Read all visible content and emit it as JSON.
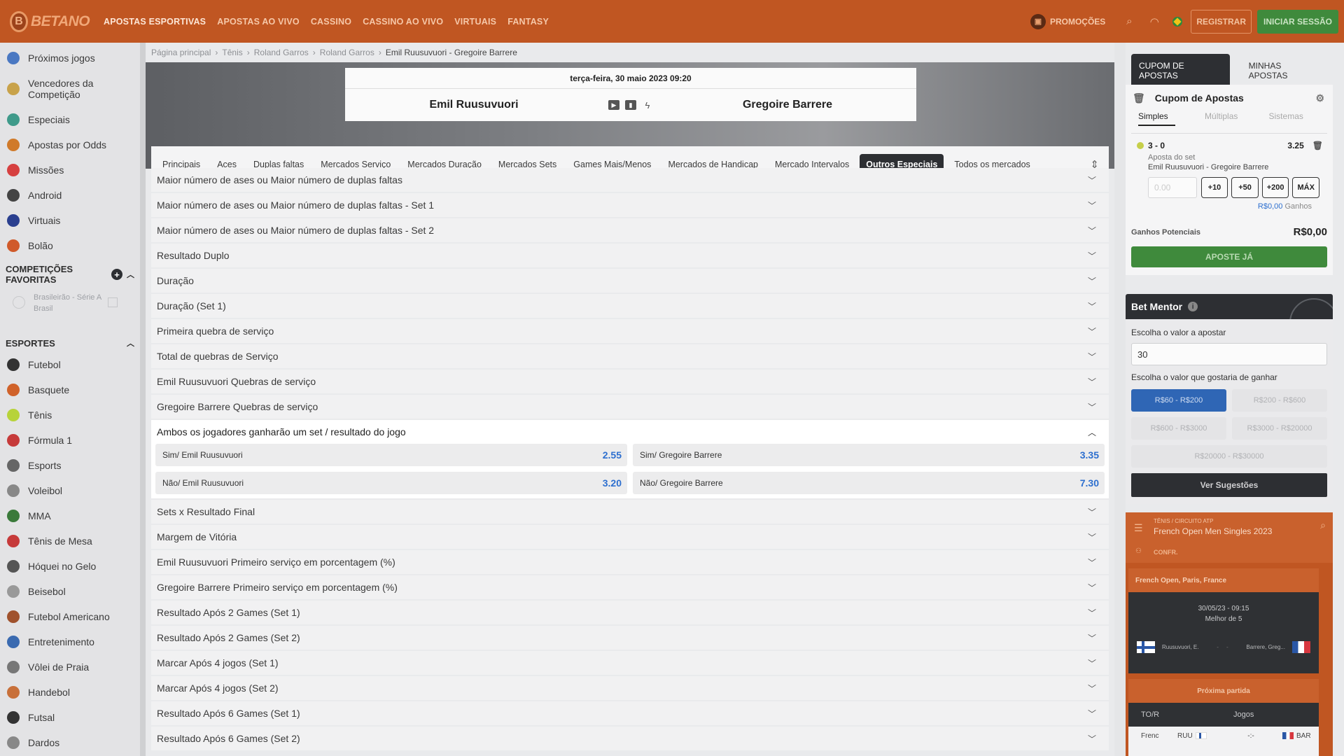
{
  "header": {
    "logo_letter": "B",
    "logo_text": "BETANO",
    "nav": [
      "APOSTAS ESPORTIVAS",
      "APOSTAS AO VIVO",
      "CASSINO",
      "CASSINO AO VIVO",
      "VIRTUAIS",
      "FANTASY"
    ],
    "promotions": "PROMOÇÕES",
    "register": "REGISTRAR",
    "login": "INICIAR SESSÃO"
  },
  "sidebar": {
    "top_items": [
      {
        "label": "Próximos jogos",
        "icon": "calendar-icon",
        "color": "#4a78c2"
      },
      {
        "label": "Vencedores da Competição",
        "icon": "trophy-icon",
        "color": "#c8a24a"
      },
      {
        "label": "Especiais",
        "icon": "star-icon",
        "color": "#3f9a8a"
      },
      {
        "label": "Apostas por Odds",
        "icon": "odds-icon",
        "color": "#d07a2a"
      },
      {
        "label": "Missões",
        "icon": "target-icon",
        "color": "#d64040"
      },
      {
        "label": "Android",
        "icon": "android-icon",
        "color": "#444444"
      },
      {
        "label": "Virtuais",
        "icon": "virtual-icon",
        "color": "#2a3f8f"
      },
      {
        "label": "Bolão",
        "icon": "bolao-icon",
        "color": "#d05a2a"
      }
    ],
    "favorites_title": "COMPETIÇÕES FAVORITAS",
    "favorite": {
      "name": "Brasileirão - Série A",
      "country": "Brasil"
    },
    "sports_title": "ESPORTES",
    "sports": [
      {
        "label": "Futebol",
        "icon": "soccer-icon",
        "color": "#333333"
      },
      {
        "label": "Basquete",
        "icon": "basketball-icon",
        "color": "#d0622a"
      },
      {
        "label": "Tênis",
        "icon": "tennis-icon",
        "color": "#b7d33a"
      },
      {
        "label": "Fórmula 1",
        "icon": "formula1-icon",
        "color": "#c63a3a"
      },
      {
        "label": "Esports",
        "icon": "esports-icon",
        "color": "#666666"
      },
      {
        "label": "Voleibol",
        "icon": "volleyball-icon",
        "color": "#888888"
      },
      {
        "label": "MMA",
        "icon": "mma-icon",
        "color": "#3a7a3a"
      },
      {
        "label": "Tênis de Mesa",
        "icon": "table-tennis-icon",
        "color": "#c63a3a"
      },
      {
        "label": "Hóquei no Gelo",
        "icon": "ice-hockey-icon",
        "color": "#555555"
      },
      {
        "label": "Beisebol",
        "icon": "baseball-icon",
        "color": "#999999"
      },
      {
        "label": "Futebol Americano",
        "icon": "american-football-icon",
        "color": "#a0522d"
      },
      {
        "label": "Entretenimento",
        "icon": "microphone-icon",
        "color": "#3a6ab0"
      },
      {
        "label": "Vôlei de Praia",
        "icon": "beach-volleyball-icon",
        "color": "#777777"
      },
      {
        "label": "Handebol",
        "icon": "handball-icon",
        "color": "#c8703a"
      },
      {
        "label": "Futsal",
        "icon": "futsal-icon",
        "color": "#333333"
      },
      {
        "label": "Dardos",
        "icon": "darts-icon",
        "color": "#888888"
      }
    ]
  },
  "breadcrumb": [
    "Página principal",
    "Tênis",
    "Roland Garros",
    "Roland Garros",
    "Emil Ruusuvuori - Gregoire Barrere"
  ],
  "match": {
    "date": "terça-feira, 30 maio 2023 09:20",
    "home": "Emil Ruusuvuori",
    "away": "Gregoire Barrere"
  },
  "tabs": [
    {
      "label": "Principais"
    },
    {
      "label": "Aces"
    },
    {
      "label": "Duplas faltas"
    },
    {
      "label": "Mercados Serviço"
    },
    {
      "label": "Mercados Duração"
    },
    {
      "label": "Mercados Sets"
    },
    {
      "label": "Games Mais/Menos"
    },
    {
      "label": "Mercados de Handicap"
    },
    {
      "label": "Mercado Intervalos"
    },
    {
      "label": "Outros Especiais",
      "active": true
    },
    {
      "label": "Todos os mercados"
    }
  ],
  "markets_before": [
    "Maior número de ases ou Maior número de duplas faltas",
    "Maior número de ases ou Maior número de duplas faltas - Set 1",
    "Maior número de ases ou Maior número de duplas faltas - Set 2",
    "Resultado Duplo",
    "Duração",
    "Duração (Set 1)",
    "Primeira quebra de serviço",
    "Total de quebras de Serviço",
    "Emil Ruusuvuori Quebras de serviço",
    "Gregoire Barrere Quebras de serviço"
  ],
  "open_market": {
    "title": "Ambos os jogadores ganharão um set / resultado do jogo",
    "odds": [
      {
        "label": "Sim/ Emil Ruusuvuori",
        "value": "2.55"
      },
      {
        "label": "Sim/ Gregoire Barrere",
        "value": "3.35"
      },
      {
        "label": "Não/ Emil Ruusuvuori",
        "value": "3.20"
      },
      {
        "label": "Não/ Gregoire Barrere",
        "value": "7.30"
      }
    ]
  },
  "markets_after": [
    "Sets x Resultado Final",
    "Margem de Vitória",
    "Emil Ruusuvuori Primeiro serviço em porcentagem (%)",
    "Gregoire Barrere Primeiro serviço em porcentagem (%)",
    "Resultado Após 2 Games (Set 1)",
    "Resultado Após 2 Games (Set 2)",
    "Marcar Após 4 jogos (Set 1)",
    "Marcar Após 4 jogos (Set 2)",
    "Resultado Após 6 Games (Set 1)",
    "Resultado Após 6 Games (Set 2)"
  ],
  "betslip": {
    "tab_coupon": "CUPOM DE APOSTAS",
    "tab_mine": "MINHAS APOSTAS",
    "title": "Cupom de Apostas",
    "types": [
      "Simples",
      "Múltiplas",
      "Sistemas"
    ],
    "bet": {
      "selection": "3 - 0",
      "odd": "3.25",
      "market": "Aposta do set",
      "match": "Emil Ruusuvuori - Gregoire Barrere",
      "stake_placeholder": "0.00",
      "quick": [
        "+10",
        "+50",
        "+200",
        "MÁX"
      ],
      "gains_value": "R$0,00",
      "gains_label": "Ganhos"
    },
    "potential_label": "Ganhos Potenciais",
    "potential_value": "R$0,00",
    "place_button": "APOSTE JÁ"
  },
  "mentor": {
    "title": "Bet Mentor",
    "stake_label": "Escolha o valor a apostar",
    "stake_value": "30",
    "win_label": "Escolha o valor que gostaria de ganhar",
    "ranges": [
      {
        "label": "R$60 - R$200",
        "active": true
      },
      {
        "label": "R$200 - R$600"
      },
      {
        "label": "R$600 - R$3000"
      },
      {
        "label": "R$3000 - R$20000"
      },
      {
        "label": "R$20000 - R$30000",
        "full": true
      }
    ],
    "suggest_button": "Ver Sugestões"
  },
  "widget": {
    "crumb": "TÊNIS / CIRCUITO ATP",
    "title": "French Open Men Singles 2023",
    "conf": "CONFR.",
    "venue": "French Open, Paris, France",
    "datetime": "30/05/23 - 09:15",
    "best_of": "Melhor de 5",
    "home_short": "Ruusuvuori, E.",
    "away_short": "Barrere, Greg...",
    "next_match": "Próxima partida",
    "col1": "TO/R",
    "col2": "Jogos",
    "row_event": "Frenc",
    "row_home": "RUU",
    "row_score": "-:-",
    "row_away": "BAR"
  }
}
